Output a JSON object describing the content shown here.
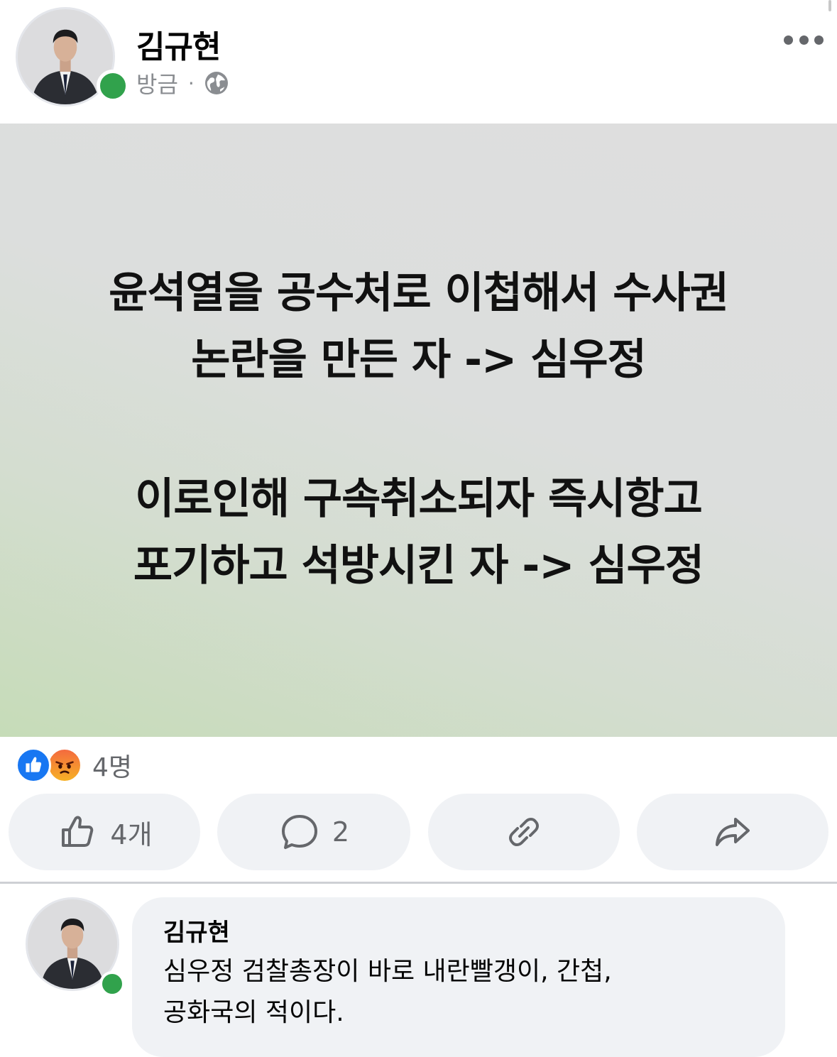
{
  "post": {
    "author": "김규현",
    "time": "방금",
    "separator": "·",
    "privacy_icon": "globe-icon",
    "more_icon": "more-horizontal-icon",
    "background_text": {
      "paragraph1_line1": "윤석열을 공수처로 이첩해서 수사권",
      "paragraph1_line2": "논란을 만든 자 -> 심우정",
      "paragraph2_line1": "이로인해 구속취소되자 즉시항고",
      "paragraph2_line2": "포기하고 석방시킨 자 -> 심우정"
    },
    "reactions": {
      "types": [
        "like",
        "angry"
      ],
      "count_label": "4명"
    }
  },
  "actions": {
    "like_count": "4개",
    "comment_count": "2",
    "link_icon": "link-icon",
    "share_icon": "share-icon"
  },
  "comment": {
    "author": "김규현",
    "line1": "심우정 검찰총장이 바로 내란빨갱이, 간첩,",
    "line2": "공화국의 적이다."
  },
  "colors": {
    "online": "#31a24c",
    "like_blue": "#1877f2",
    "button_bg": "#f0f2f5",
    "secondary_text": "#65676b"
  }
}
